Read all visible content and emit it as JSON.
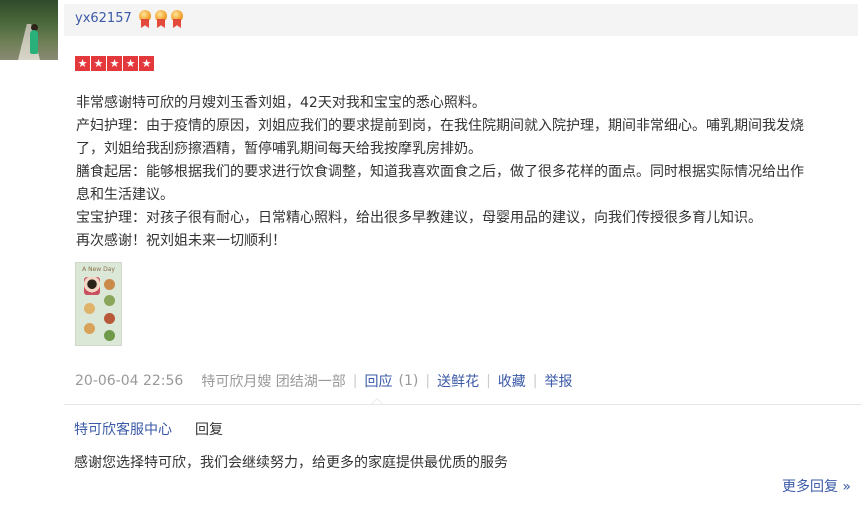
{
  "user": {
    "name": "yx62157",
    "medal_count": 3
  },
  "rating": {
    "stars": 5,
    "max": 5,
    "star_glyph": "★",
    "color": "#e4393c"
  },
  "review": {
    "lines": [
      "非常感谢特可欣的月嫂刘玉香刘姐，42天对我和宝宝的悉心照料。",
      "产妇护理：由于疫情的原因，刘姐应我们的要求提前到岗，在我住院期间就入院护理，期间非常细心。哺乳期间我发烧",
      "了，刘姐给我刮痧擦酒精，暂停哺乳期间每天给我按摩乳房排奶。",
      "膳食起居：能够根据我们的要求进行饮食调整，知道我喜欢面食之后，做了很多花样的面点。同时根据实际情况给出作",
      "息和生活建议。",
      "宝宝护理：对孩子很有耐心，日常精心照料，给出很多早教建议，母婴用品的建议，向我们传授很多育儿知识。",
      "再次感谢！祝刘姐未来一切顺利！"
    ]
  },
  "thumbnail": {
    "caption": "A New Day"
  },
  "meta": {
    "date": "20-06-04 22:56",
    "service": "特可欣月嫂 团结湖一部",
    "reply_label": "回应",
    "reply_count": "(1)",
    "flower_label": "送鲜花",
    "collect_label": "收藏",
    "report_label": "举报"
  },
  "reply": {
    "author": "特可欣客服中心",
    "tag": "回复",
    "text": "感谢您选择特可欣，我们会继续努力，给更多的家庭提供最优质的服务"
  },
  "more_replies": "更多回复 »",
  "colors": {
    "link": "#3b5aa7",
    "muted": "#999999",
    "header_bg": "#f4f4f4"
  }
}
